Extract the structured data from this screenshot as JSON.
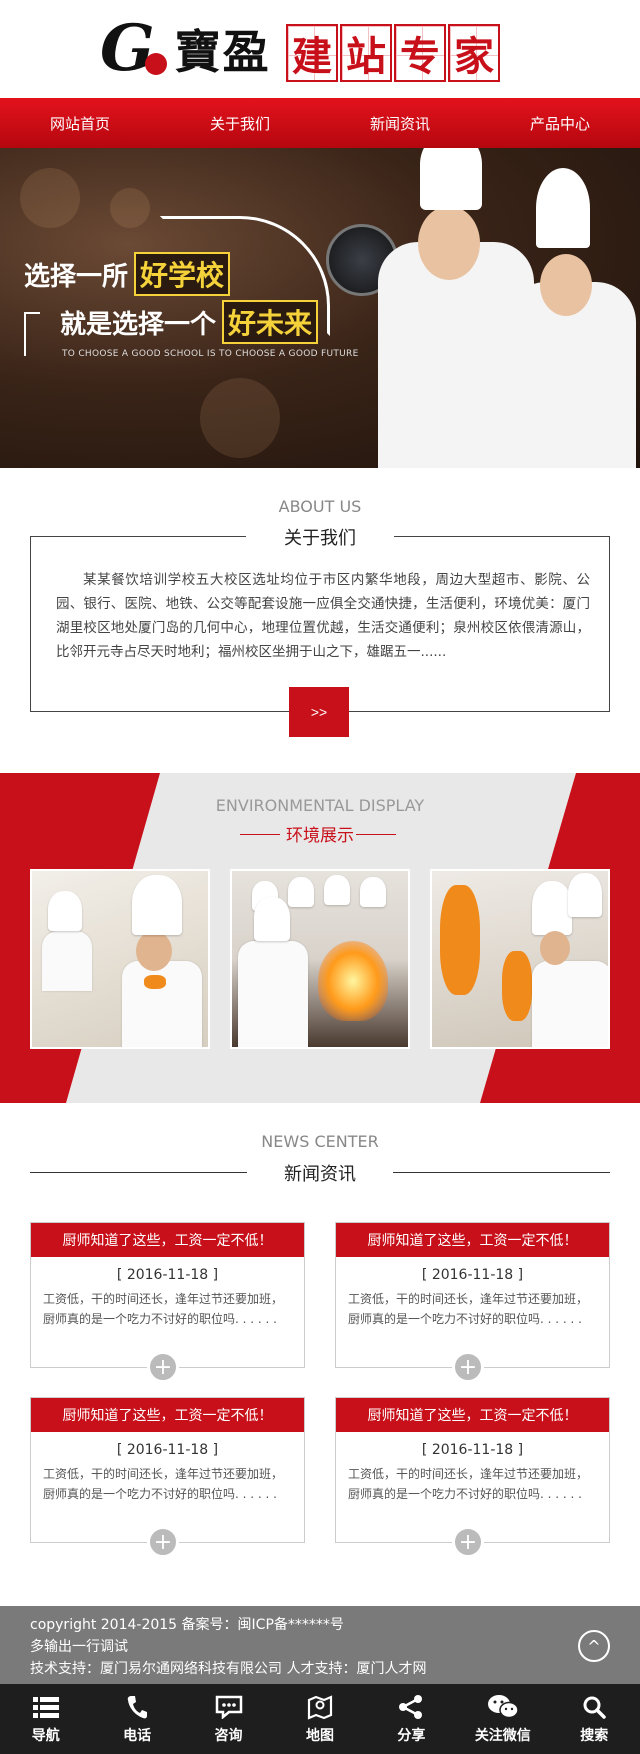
{
  "header": {
    "logo_letter": "G",
    "logo_text": "寶盈",
    "slogan": [
      "建",
      "站",
      "专",
      "家"
    ]
  },
  "nav": {
    "items": [
      {
        "label": "网站首页"
      },
      {
        "label": "关于我们"
      },
      {
        "label": "新闻资讯"
      },
      {
        "label": "产品中心"
      }
    ]
  },
  "banner": {
    "line1_prefix": "选择一所",
    "line1_highlight": "好学校",
    "line2_prefix": "就是选择一个",
    "line2_highlight": "好未来",
    "subtitle": "TO CHOOSE A GOOD SCHOOL IS TO CHOOSE A GOOD FUTURE"
  },
  "about": {
    "title_en": "ABOUT US",
    "title": "关于我们",
    "text": "某某餐饮培训学校五大校区选址均位于市区内繁华地段，周边大型超市、影院、公园、银行、医院、地铁、公交等配套设施一应俱全交通快捷，生活便利，环境优美：厦门湖里校区地处厦门岛的几何中心，地理位置优越，生活交通便利；泉州校区依偎清源山，比邻开元寺占尽天时地利；福州校区坐拥于山之下，雄踞五一......",
    "more_label": ">>"
  },
  "environment": {
    "title_en": "ENVIRONMENTAL DISPLAY",
    "title": "环境展示"
  },
  "news": {
    "title_en": "NEWS CENTER",
    "title": "新闻资讯",
    "items": [
      {
        "title": "厨师知道了这些，工资一定不低！",
        "date": "[ 2016-11-18 ]",
        "summary": "工资低，干的时间还长，逢年过节还要加班，厨师真的是一个吃力不讨好的职位吗. . . . . ."
      },
      {
        "title": "厨师知道了这些，工资一定不低！",
        "date": "[ 2016-11-18 ]",
        "summary": "工资低，干的时间还长，逢年过节还要加班，厨师真的是一个吃力不讨好的职位吗. . . . . ."
      },
      {
        "title": "厨师知道了这些，工资一定不低！",
        "date": "[ 2016-11-18 ]",
        "summary": "工资低，干的时间还长，逢年过节还要加班，厨师真的是一个吃力不讨好的职位吗. . . . . ."
      },
      {
        "title": "厨师知道了这些，工资一定不低！",
        "date": "[ 2016-11-18 ]",
        "summary": "工资低，干的时间还长，逢年过节还要加班，厨师真的是一个吃力不讨好的职位吗. . . . . ."
      }
    ],
    "more_symbol": "+"
  },
  "footer": {
    "line1": "copyright 2014-2015 备案号：闽ICP备******号",
    "line2": "多输出一行调试",
    "line3": "技术支持：厦门易尔通网络科技有限公司 人才支持：厦门人才网",
    "top_symbol": "^"
  },
  "bottom_bar": {
    "items": [
      {
        "label": "导航",
        "icon": "list-icon"
      },
      {
        "label": "电话",
        "icon": "phone-icon"
      },
      {
        "label": "咨询",
        "icon": "chat-icon"
      },
      {
        "label": "地图",
        "icon": "map-icon"
      },
      {
        "label": "分享",
        "icon": "share-icon"
      },
      {
        "label": "关注微信",
        "icon": "wechat-icon"
      },
      {
        "label": "搜索",
        "icon": "search-icon"
      }
    ]
  },
  "colors": {
    "brand_red": "#c8101a",
    "footer_gray": "#7a7a7a",
    "bar_dark": "#1e1e1e"
  }
}
